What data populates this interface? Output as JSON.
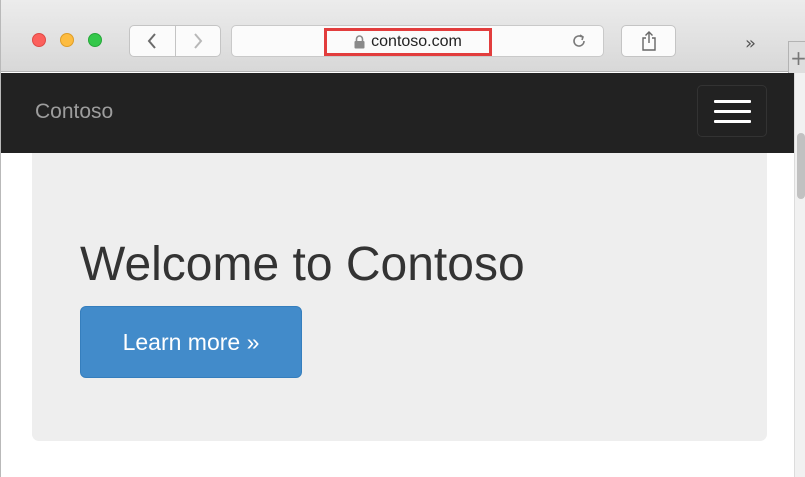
{
  "browser": {
    "url": "contoso.com",
    "overflow_glyph": "»",
    "new_tab_glyph": "+",
    "colors": {
      "close": "#fc605c",
      "minimize": "#fdbc40",
      "zoom": "#34c84a",
      "url_highlight": "#e23d3d"
    },
    "icons": {
      "back": "chevron-left-icon",
      "forward": "chevron-right-icon",
      "lock": "lock-icon",
      "reload": "reload-icon",
      "share": "share-icon"
    }
  },
  "site": {
    "brand": "Contoso",
    "menu_icon": "hamburger-menu-icon",
    "heading": "Welcome to Contoso",
    "cta_label": "Learn more »",
    "colors": {
      "navbar": "#222222",
      "jumbotron": "#eeeeee",
      "cta": "#428bca"
    }
  }
}
